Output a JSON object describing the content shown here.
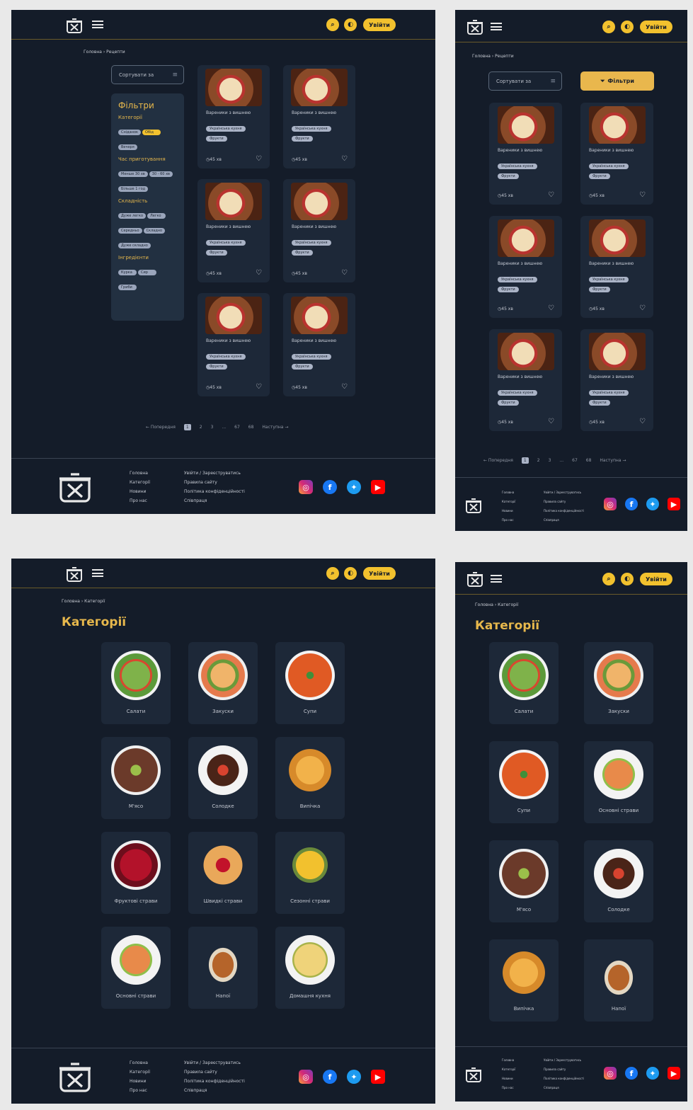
{
  "header": {
    "login_label": "Увійти"
  },
  "breadcrumbs": {
    "recipes": "Головна › Рецепти",
    "categories": "Головна › Категорії"
  },
  "recipes_page": {
    "sort_label": "Сортувати за",
    "filter_button_label": "Фільтри",
    "filters": {
      "title": "Фільтри",
      "groups": [
        {
          "title": "Категорії",
          "options": [
            "Сніданок",
            "Обід",
            "Вечеря"
          ]
        },
        {
          "title": "Час приготування",
          "options": [
            "Менше 30 хв",
            "30 - 60 хв",
            "Більше 1 год"
          ]
        },
        {
          "title": "Складність",
          "options": [
            "Дуже легко",
            "Легко",
            "Середньо",
            "Складно",
            "Дуже складно"
          ]
        },
        {
          "title": "Інгредієнти",
          "options": [
            "Курка",
            "Сир",
            "Гриби"
          ]
        }
      ]
    },
    "card": {
      "name": "Вареники з вишнею",
      "tag_cuisine": "Українська кухня",
      "tag_type": "Фрукти",
      "time": "45 хв"
    },
    "pagination": {
      "prev": "← Попередня",
      "pages": [
        "1",
        "2",
        "3",
        "...",
        "67",
        "68"
      ],
      "next": "Наступна →"
    }
  },
  "categories_page": {
    "title": "Категорії",
    "items": [
      "Салати",
      "Закуски",
      "Супи",
      "М'ясо",
      "Солодке",
      "Випічка",
      "Фруктові страви",
      "Швидкі страви",
      "Сезонні страви",
      "Основні страви",
      "Напої",
      "Домашня кухня"
    ]
  },
  "footer": {
    "col1": [
      "Головна",
      "Категорії",
      "Новини",
      "Про нас"
    ],
    "col2": [
      "Увійти / Зареєструватись",
      "Правила сайту",
      "Політика конфіденційності",
      "Співпраця"
    ]
  },
  "colors": {
    "bg": "#141c29",
    "accent": "#f2c12e",
    "card": "#1d2838"
  },
  "icons": [
    "pot-logo-icon",
    "menu-icon",
    "search-icon",
    "theme-icon",
    "clock-icon",
    "heart-icon",
    "instagram-icon",
    "facebook-icon",
    "twitter-icon",
    "youtube-icon"
  ]
}
